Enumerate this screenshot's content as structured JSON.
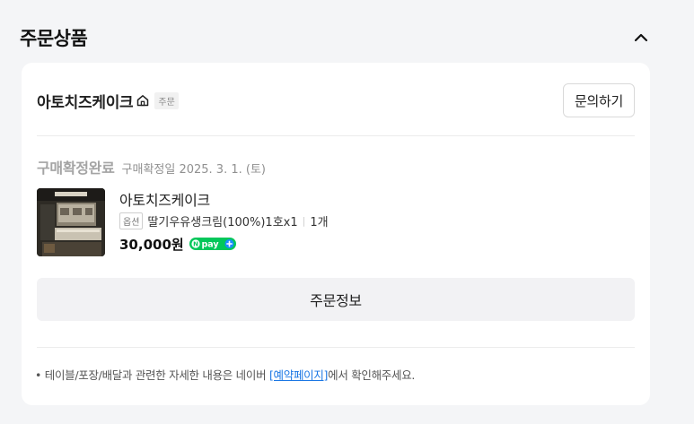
{
  "section": {
    "title": "주문상품",
    "collapse_icon": "chevron-up-icon"
  },
  "store": {
    "name": "아토치즈케이크",
    "home_icon": "home-icon",
    "order_tag": "주문",
    "inquiry_label": "문의하기"
  },
  "order": {
    "status": "구매확정완료",
    "confirm_date": "구매확정일 2025. 3. 1. (토)"
  },
  "product": {
    "name": "아토치즈케이크",
    "option_tag": "옵션",
    "option_value": "딸기우유생크림(100%)1호x1",
    "separator": "|",
    "quantity": "1개",
    "price": "30,000원",
    "pay_badge": "N pay +",
    "pay_color": "#03c75a"
  },
  "actions": {
    "order_info_label": "주문정보"
  },
  "notice": {
    "bullet": "•",
    "prefix": "테이블/포장/배달과 관련한 자세한 내용은 네이버 ",
    "link": "[예약페이지]",
    "suffix": "에서 확인해주세요.",
    "link_color": "#1b77e4"
  }
}
